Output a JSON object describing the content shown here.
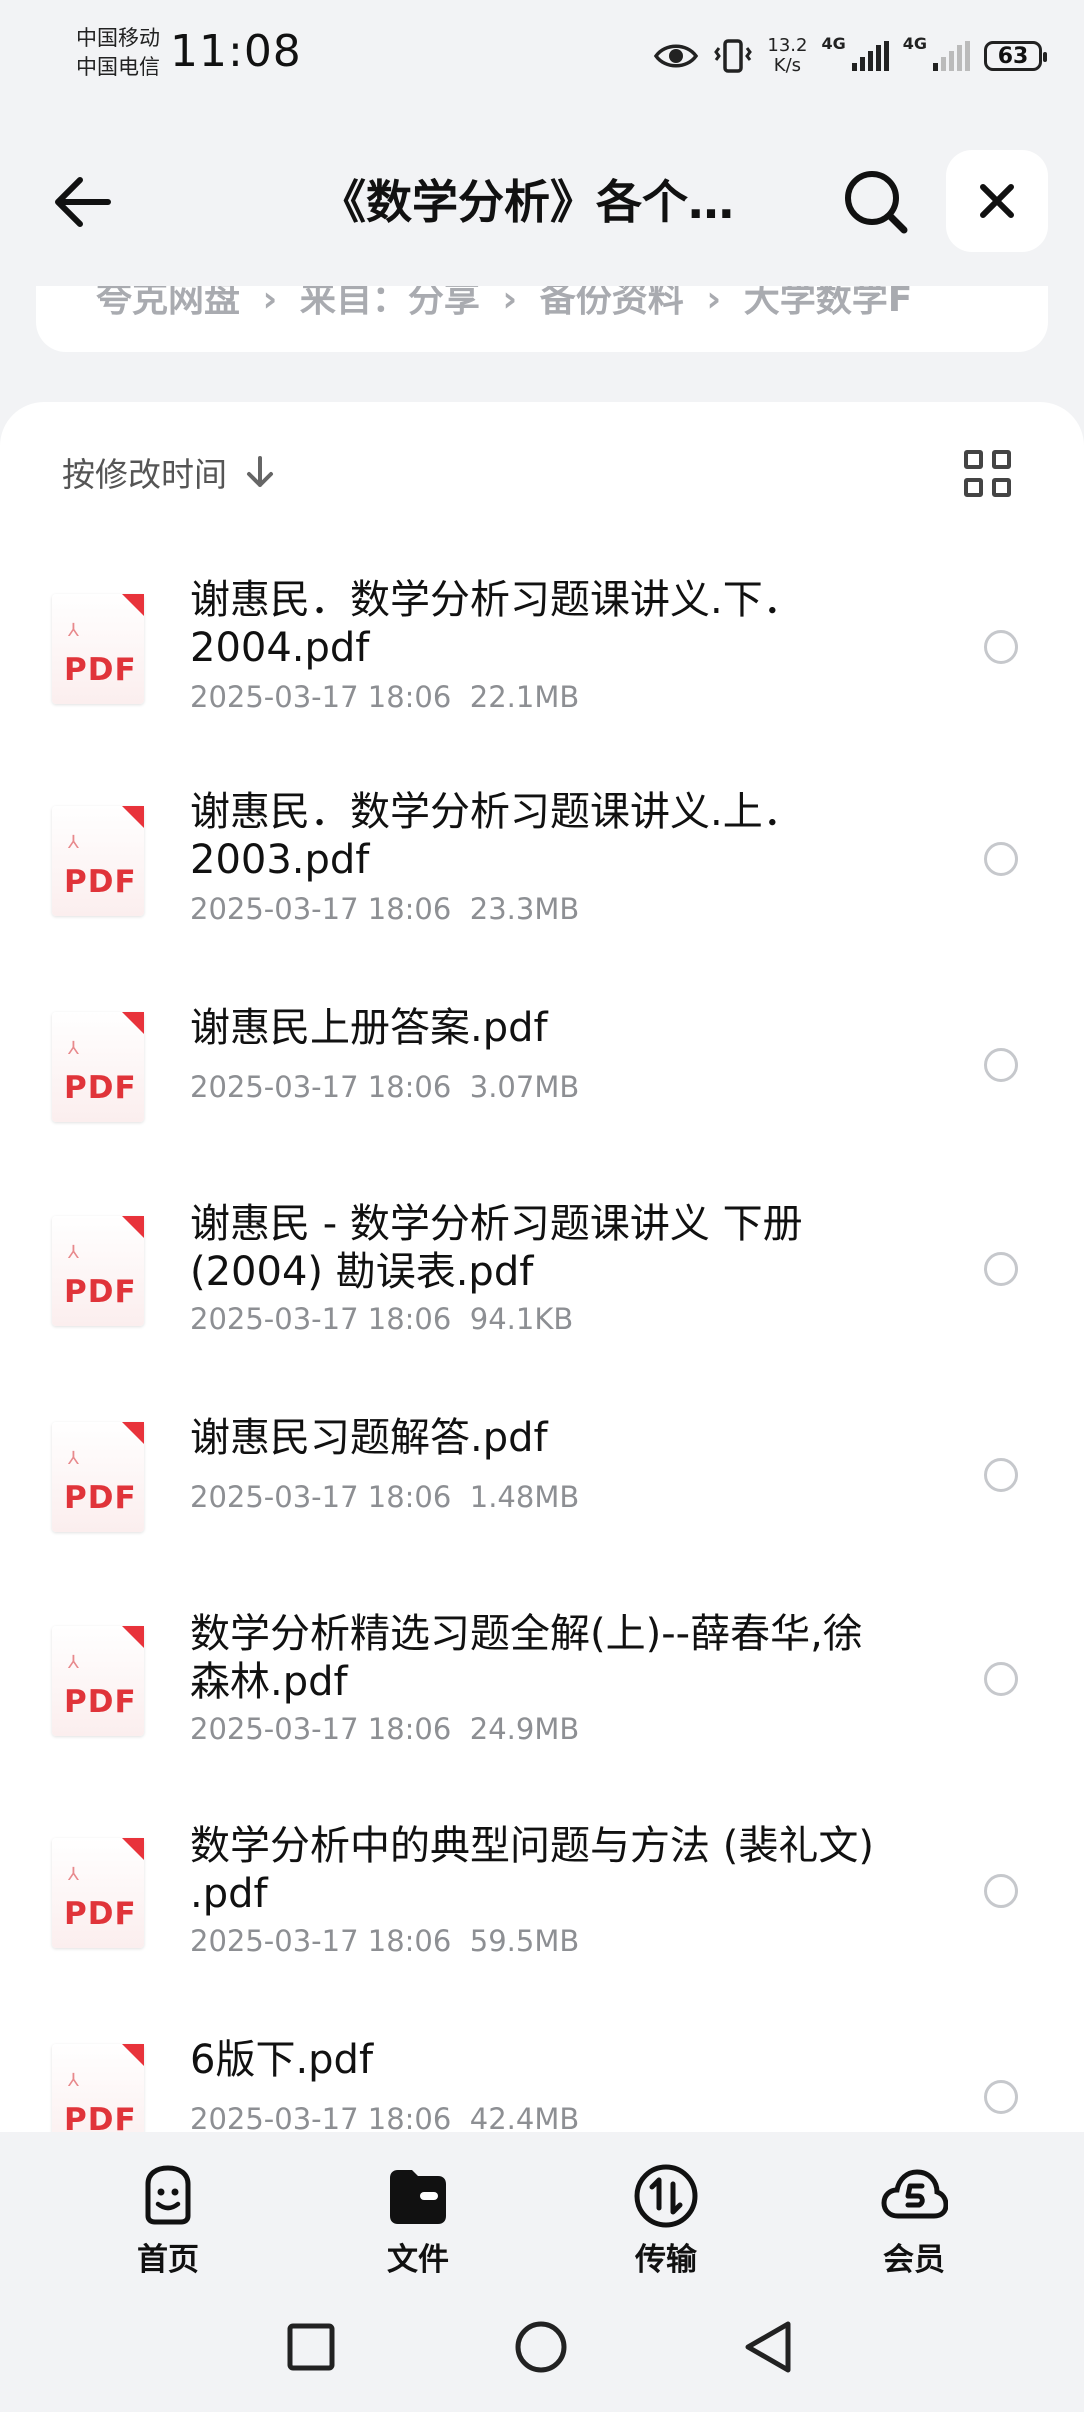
{
  "status_bar": {
    "carrier_1": "中国移动",
    "carrier_2": "中国电信",
    "time": "11:08",
    "speed_value": "13.2",
    "speed_unit": "K/s",
    "net_1": "4G",
    "net_2": "4G",
    "battery": "63"
  },
  "header": {
    "title": "《数学分析》各个…"
  },
  "breadcrumb": {
    "text": "夸克网盘 › 来自：分享 › 备份资料 › 大学数学F"
  },
  "sort": {
    "label": "按修改时间"
  },
  "files": [
    {
      "name": "谢惠民．数学分析习题课讲义.下．2004.pdf",
      "date": "2025-03-17 18:06",
      "size": "22.1MB"
    },
    {
      "name": "谢惠民．数学分析习题课讲义.上．2003.pdf",
      "date": "2025-03-17 18:06",
      "size": "23.3MB"
    },
    {
      "name": "谢惠民上册答案.pdf",
      "date": "2025-03-17 18:06",
      "size": "3.07MB"
    },
    {
      "name": "谢惠民 - 数学分析习题课讲义 下册 (2004) 勘误表.pdf",
      "date": "2025-03-17 18:06",
      "size": "94.1KB"
    },
    {
      "name": "谢惠民习题解答.pdf",
      "date": "2025-03-17 18:06",
      "size": "1.48MB"
    },
    {
      "name": "数学分析精选习题全解(上)--薛春华,徐森林.pdf",
      "date": "2025-03-17 18:06",
      "size": "24.9MB"
    },
    {
      "name": "数学分析中的典型问题与方法 (裴礼文) .pdf",
      "date": "2025-03-17 18:06",
      "size": "59.5MB"
    },
    {
      "name": "6版下.pdf",
      "date": "2025-03-17 18:06",
      "size": "42.4MB"
    }
  ],
  "file_icon_label": "PDF",
  "tabs": {
    "home": "首页",
    "files": "文件",
    "transfer": "传输",
    "vip": "会员"
  },
  "colors": {
    "pdf_red": "#e0343a",
    "background": "#f2f3f5"
  }
}
